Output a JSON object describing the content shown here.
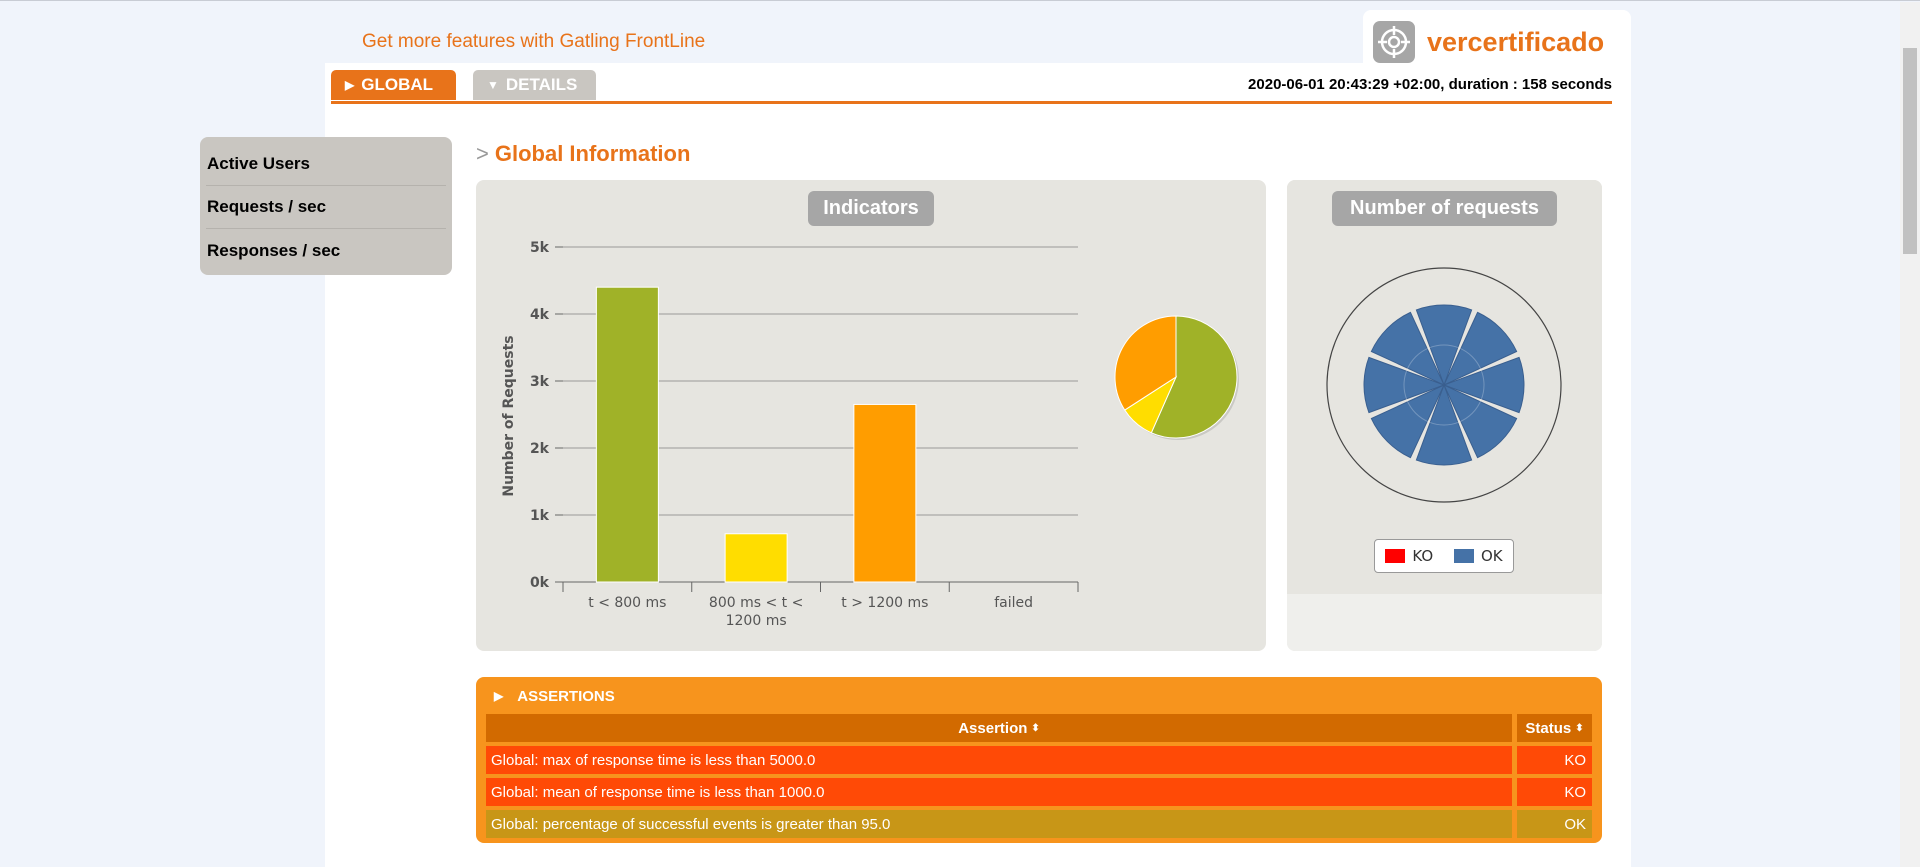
{
  "promo": {
    "text": "Get more features with Gatling FrontLine"
  },
  "logo": {
    "text": "vercertificado"
  },
  "tabs": [
    {
      "label": "GLOBAL",
      "active": true
    },
    {
      "label": "DETAILS",
      "active": false
    }
  ],
  "run_info": "2020-06-01 20:43:29 +02:00, duration : 158 seconds",
  "sidebar": {
    "items": [
      {
        "label": "Active Users"
      },
      {
        "label": "Requests / sec"
      },
      {
        "label": "Responses / sec"
      }
    ]
  },
  "section": {
    "marker": ">",
    "title": "Global Information"
  },
  "indicators": {
    "title": "Indicators"
  },
  "requests_panel": {
    "title": "Number of requests",
    "legend": [
      {
        "label": "KO",
        "color": "#ff0000"
      },
      {
        "label": "OK",
        "color": "#4572a7"
      }
    ]
  },
  "chart_data": [
    {
      "type": "bar",
      "title": "Indicators",
      "ylabel": "Number of Requests",
      "xlabel": "",
      "categories": [
        "t < 800 ms",
        "800 ms < t < 1200 ms",
        "t > 1200 ms",
        "failed"
      ],
      "values": [
        4400,
        720,
        2650,
        0
      ],
      "colors": [
        "#a0b228",
        "#ffdd00",
        "#ff9d00",
        "#f15b4f"
      ],
      "ylim": [
        0,
        5000
      ],
      "yticks": [
        "0k",
        "1k",
        "2k",
        "3k",
        "4k",
        "5k"
      ],
      "grid": true
    },
    {
      "type": "pie",
      "labels": [
        "t < 800 ms",
        "800 ms < t < 1200 ms",
        "t > 1200 ms",
        "failed"
      ],
      "values": [
        4400,
        720,
        2650,
        0
      ],
      "colors": [
        "#a0b228",
        "#ffdd00",
        "#ff9d00",
        "#f15b4f"
      ]
    },
    {
      "type": "pie",
      "title": "Number of requests",
      "series": [
        {
          "name": "OK",
          "values": [
            1,
            1,
            1,
            1,
            1,
            1,
            1,
            1
          ]
        },
        {
          "name": "KO",
          "values": [
            0,
            0,
            0,
            0,
            0,
            0,
            0,
            0
          ]
        }
      ]
    }
  ],
  "assertions": {
    "header": "ASSERTIONS",
    "columns": {
      "assertion": "Assertion",
      "status": "Status"
    },
    "rows": [
      {
        "assertion": "Global: max of response time is less than 5000.0",
        "status": "KO"
      },
      {
        "assertion": "Global: mean of response time is less than 1000.0",
        "status": "KO"
      },
      {
        "assertion": "Global: percentage of successful events is greater than 95.0",
        "status": "OK"
      }
    ]
  }
}
